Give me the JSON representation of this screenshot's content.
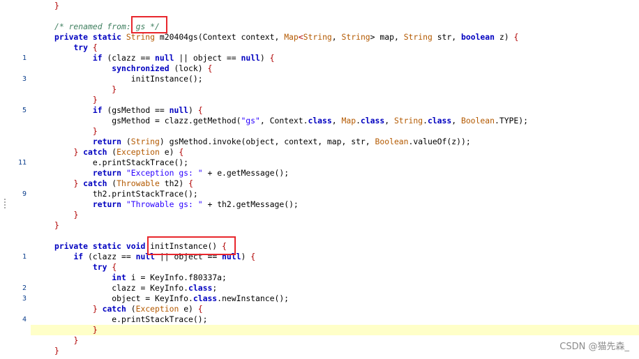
{
  "editor": {
    "watermark": "CSDN @猫先森_",
    "lines": [
      {
        "ln": "",
        "segs": [
          {
            "t": "}",
            "c": "pu"
          }
        ]
      },
      {
        "ln": "",
        "segs": []
      },
      {
        "ln": "",
        "segs": [
          {
            "t": "/* renamed from: gs */",
            "c": "cm"
          }
        ]
      },
      {
        "ln": "",
        "segs": [
          {
            "t": "private static ",
            "c": "kw"
          },
          {
            "t": "String",
            "c": "ty"
          },
          {
            "t": " m20404gs(Context context, "
          },
          {
            "t": "Map",
            "c": "ty"
          },
          {
            "t": "<",
            "c": "pu"
          },
          {
            "t": "String",
            "c": "ty"
          },
          {
            "t": ", "
          },
          {
            "t": "String",
            "c": "ty"
          },
          {
            "t": "> map, "
          },
          {
            "t": "String",
            "c": "ty"
          },
          {
            "t": " str, "
          },
          {
            "t": "boolean",
            "c": "kw"
          },
          {
            "t": " z) "
          },
          {
            "t": "{",
            "c": "pu"
          }
        ]
      },
      {
        "ln": "",
        "segs": [
          {
            "t": "    "
          },
          {
            "t": "try",
            "c": "kw"
          },
          {
            "t": " "
          },
          {
            "t": "{",
            "c": "pu"
          }
        ]
      },
      {
        "ln": "1",
        "segs": [
          {
            "t": "        "
          },
          {
            "t": "if",
            "c": "kw"
          },
          {
            "t": " (clazz == "
          },
          {
            "t": "null",
            "c": "kw"
          },
          {
            "t": " || object == "
          },
          {
            "t": "null",
            "c": "kw"
          },
          {
            "t": ") "
          },
          {
            "t": "{",
            "c": "pu"
          }
        ]
      },
      {
        "ln": "",
        "segs": [
          {
            "t": "            "
          },
          {
            "t": "synchronized",
            "c": "kw"
          },
          {
            "t": " (lock) "
          },
          {
            "t": "{",
            "c": "pu"
          }
        ]
      },
      {
        "ln": "3",
        "segs": [
          {
            "t": "                initInstance();"
          }
        ]
      },
      {
        "ln": "",
        "segs": [
          {
            "t": "            "
          },
          {
            "t": "}",
            "c": "pu"
          }
        ]
      },
      {
        "ln": "",
        "segs": [
          {
            "t": "        "
          },
          {
            "t": "}",
            "c": "pu"
          }
        ]
      },
      {
        "ln": "5",
        "segs": [
          {
            "t": "        "
          },
          {
            "t": "if",
            "c": "kw"
          },
          {
            "t": " (gsMethod == "
          },
          {
            "t": "null",
            "c": "kw"
          },
          {
            "t": ") "
          },
          {
            "t": "{",
            "c": "pu"
          }
        ]
      },
      {
        "ln": "",
        "segs": [
          {
            "t": "            gsMethod = clazz.getMethod("
          },
          {
            "t": "\"gs\"",
            "c": "st"
          },
          {
            "t": ", Context."
          },
          {
            "t": "class",
            "c": "kw"
          },
          {
            "t": ", "
          },
          {
            "t": "Map",
            "c": "ty"
          },
          {
            "t": "."
          },
          {
            "t": "class",
            "c": "kw"
          },
          {
            "t": ", "
          },
          {
            "t": "String",
            "c": "ty"
          },
          {
            "t": "."
          },
          {
            "t": "class",
            "c": "kw"
          },
          {
            "t": ", "
          },
          {
            "t": "Boolean",
            "c": "ty"
          },
          {
            "t": ".TYPE);"
          }
        ]
      },
      {
        "ln": "",
        "segs": [
          {
            "t": "        "
          },
          {
            "t": "}",
            "c": "pu"
          }
        ]
      },
      {
        "ln": "",
        "segs": [
          {
            "t": "        "
          },
          {
            "t": "return",
            "c": "kw"
          },
          {
            "t": " ("
          },
          {
            "t": "String",
            "c": "ty"
          },
          {
            "t": ") gsMethod.invoke(object, context, map, str, "
          },
          {
            "t": "Boolean",
            "c": "ty"
          },
          {
            "t": ".valueOf(z));"
          }
        ]
      },
      {
        "ln": "",
        "segs": [
          {
            "t": "    "
          },
          {
            "t": "}",
            "c": "pu"
          },
          {
            "t": " "
          },
          {
            "t": "catch",
            "c": "kw"
          },
          {
            "t": " ("
          },
          {
            "t": "Exception",
            "c": "ty"
          },
          {
            "t": " e) "
          },
          {
            "t": "{",
            "c": "pu"
          }
        ]
      },
      {
        "ln": "11",
        "segs": [
          {
            "t": "        e.printStackTrace();"
          }
        ]
      },
      {
        "ln": "",
        "segs": [
          {
            "t": "        "
          },
          {
            "t": "return",
            "c": "kw"
          },
          {
            "t": " "
          },
          {
            "t": "\"Exception gs: \"",
            "c": "st"
          },
          {
            "t": " + e.getMessage();"
          }
        ]
      },
      {
        "ln": "",
        "segs": [
          {
            "t": "    "
          },
          {
            "t": "}",
            "c": "pu"
          },
          {
            "t": " "
          },
          {
            "t": "catch",
            "c": "kw"
          },
          {
            "t": " ("
          },
          {
            "t": "Throwable",
            "c": "ty"
          },
          {
            "t": " th2) "
          },
          {
            "t": "{",
            "c": "pu"
          }
        ]
      },
      {
        "ln": "9",
        "segs": [
          {
            "t": "        th2.printStackTrace();"
          }
        ]
      },
      {
        "ln": "",
        "segs": [
          {
            "t": "        "
          },
          {
            "t": "return",
            "c": "kw"
          },
          {
            "t": " "
          },
          {
            "t": "\"Throwable gs: \"",
            "c": "st"
          },
          {
            "t": " + th2.getMessage();"
          }
        ]
      },
      {
        "ln": "",
        "segs": [
          {
            "t": "    "
          },
          {
            "t": "}",
            "c": "pu"
          }
        ]
      },
      {
        "ln": "",
        "segs": [
          {
            "t": "}",
            "c": "pu"
          }
        ]
      },
      {
        "ln": "",
        "segs": []
      },
      {
        "ln": "",
        "segs": [
          {
            "t": "private static void ",
            "c": "kw"
          },
          {
            "t": "initInstance() "
          },
          {
            "t": "{",
            "c": "pu"
          }
        ]
      },
      {
        "ln": "1",
        "segs": [
          {
            "t": "    "
          },
          {
            "t": "if",
            "c": "kw"
          },
          {
            "t": " (clazz == "
          },
          {
            "t": "null",
            "c": "kw"
          },
          {
            "t": " || object == "
          },
          {
            "t": "null",
            "c": "kw"
          },
          {
            "t": ") "
          },
          {
            "t": "{",
            "c": "pu"
          }
        ]
      },
      {
        "ln": "",
        "segs": [
          {
            "t": "        "
          },
          {
            "t": "try",
            "c": "kw"
          },
          {
            "t": " "
          },
          {
            "t": "{",
            "c": "pu"
          }
        ]
      },
      {
        "ln": "",
        "segs": [
          {
            "t": "            "
          },
          {
            "t": "int",
            "c": "kw"
          },
          {
            "t": " i = KeyInfo.f80337a;"
          }
        ]
      },
      {
        "ln": "2",
        "segs": [
          {
            "t": "            clazz = KeyInfo."
          },
          {
            "t": "class",
            "c": "kw"
          },
          {
            "t": ";"
          }
        ]
      },
      {
        "ln": "3",
        "segs": [
          {
            "t": "            object = KeyInfo."
          },
          {
            "t": "class",
            "c": "kw"
          },
          {
            "t": ".newInstance();"
          }
        ]
      },
      {
        "ln": "",
        "segs": [
          {
            "t": "        "
          },
          {
            "t": "}",
            "c": "pu"
          },
          {
            "t": " "
          },
          {
            "t": "catch",
            "c": "kw"
          },
          {
            "t": " ("
          },
          {
            "t": "Exception",
            "c": "ty"
          },
          {
            "t": " e) "
          },
          {
            "t": "{",
            "c": "pu"
          }
        ]
      },
      {
        "ln": "4",
        "segs": [
          {
            "t": "            e.printStackTrace();"
          }
        ]
      },
      {
        "ln": "",
        "hl": true,
        "segs": [
          {
            "t": "        "
          },
          {
            "t": "}",
            "c": "pu"
          }
        ]
      },
      {
        "ln": "",
        "segs": [
          {
            "t": "    "
          },
          {
            "t": "}",
            "c": "pu"
          }
        ]
      },
      {
        "ln": "",
        "segs": [
          {
            "t": "}",
            "c": "pu"
          }
        ]
      }
    ]
  }
}
